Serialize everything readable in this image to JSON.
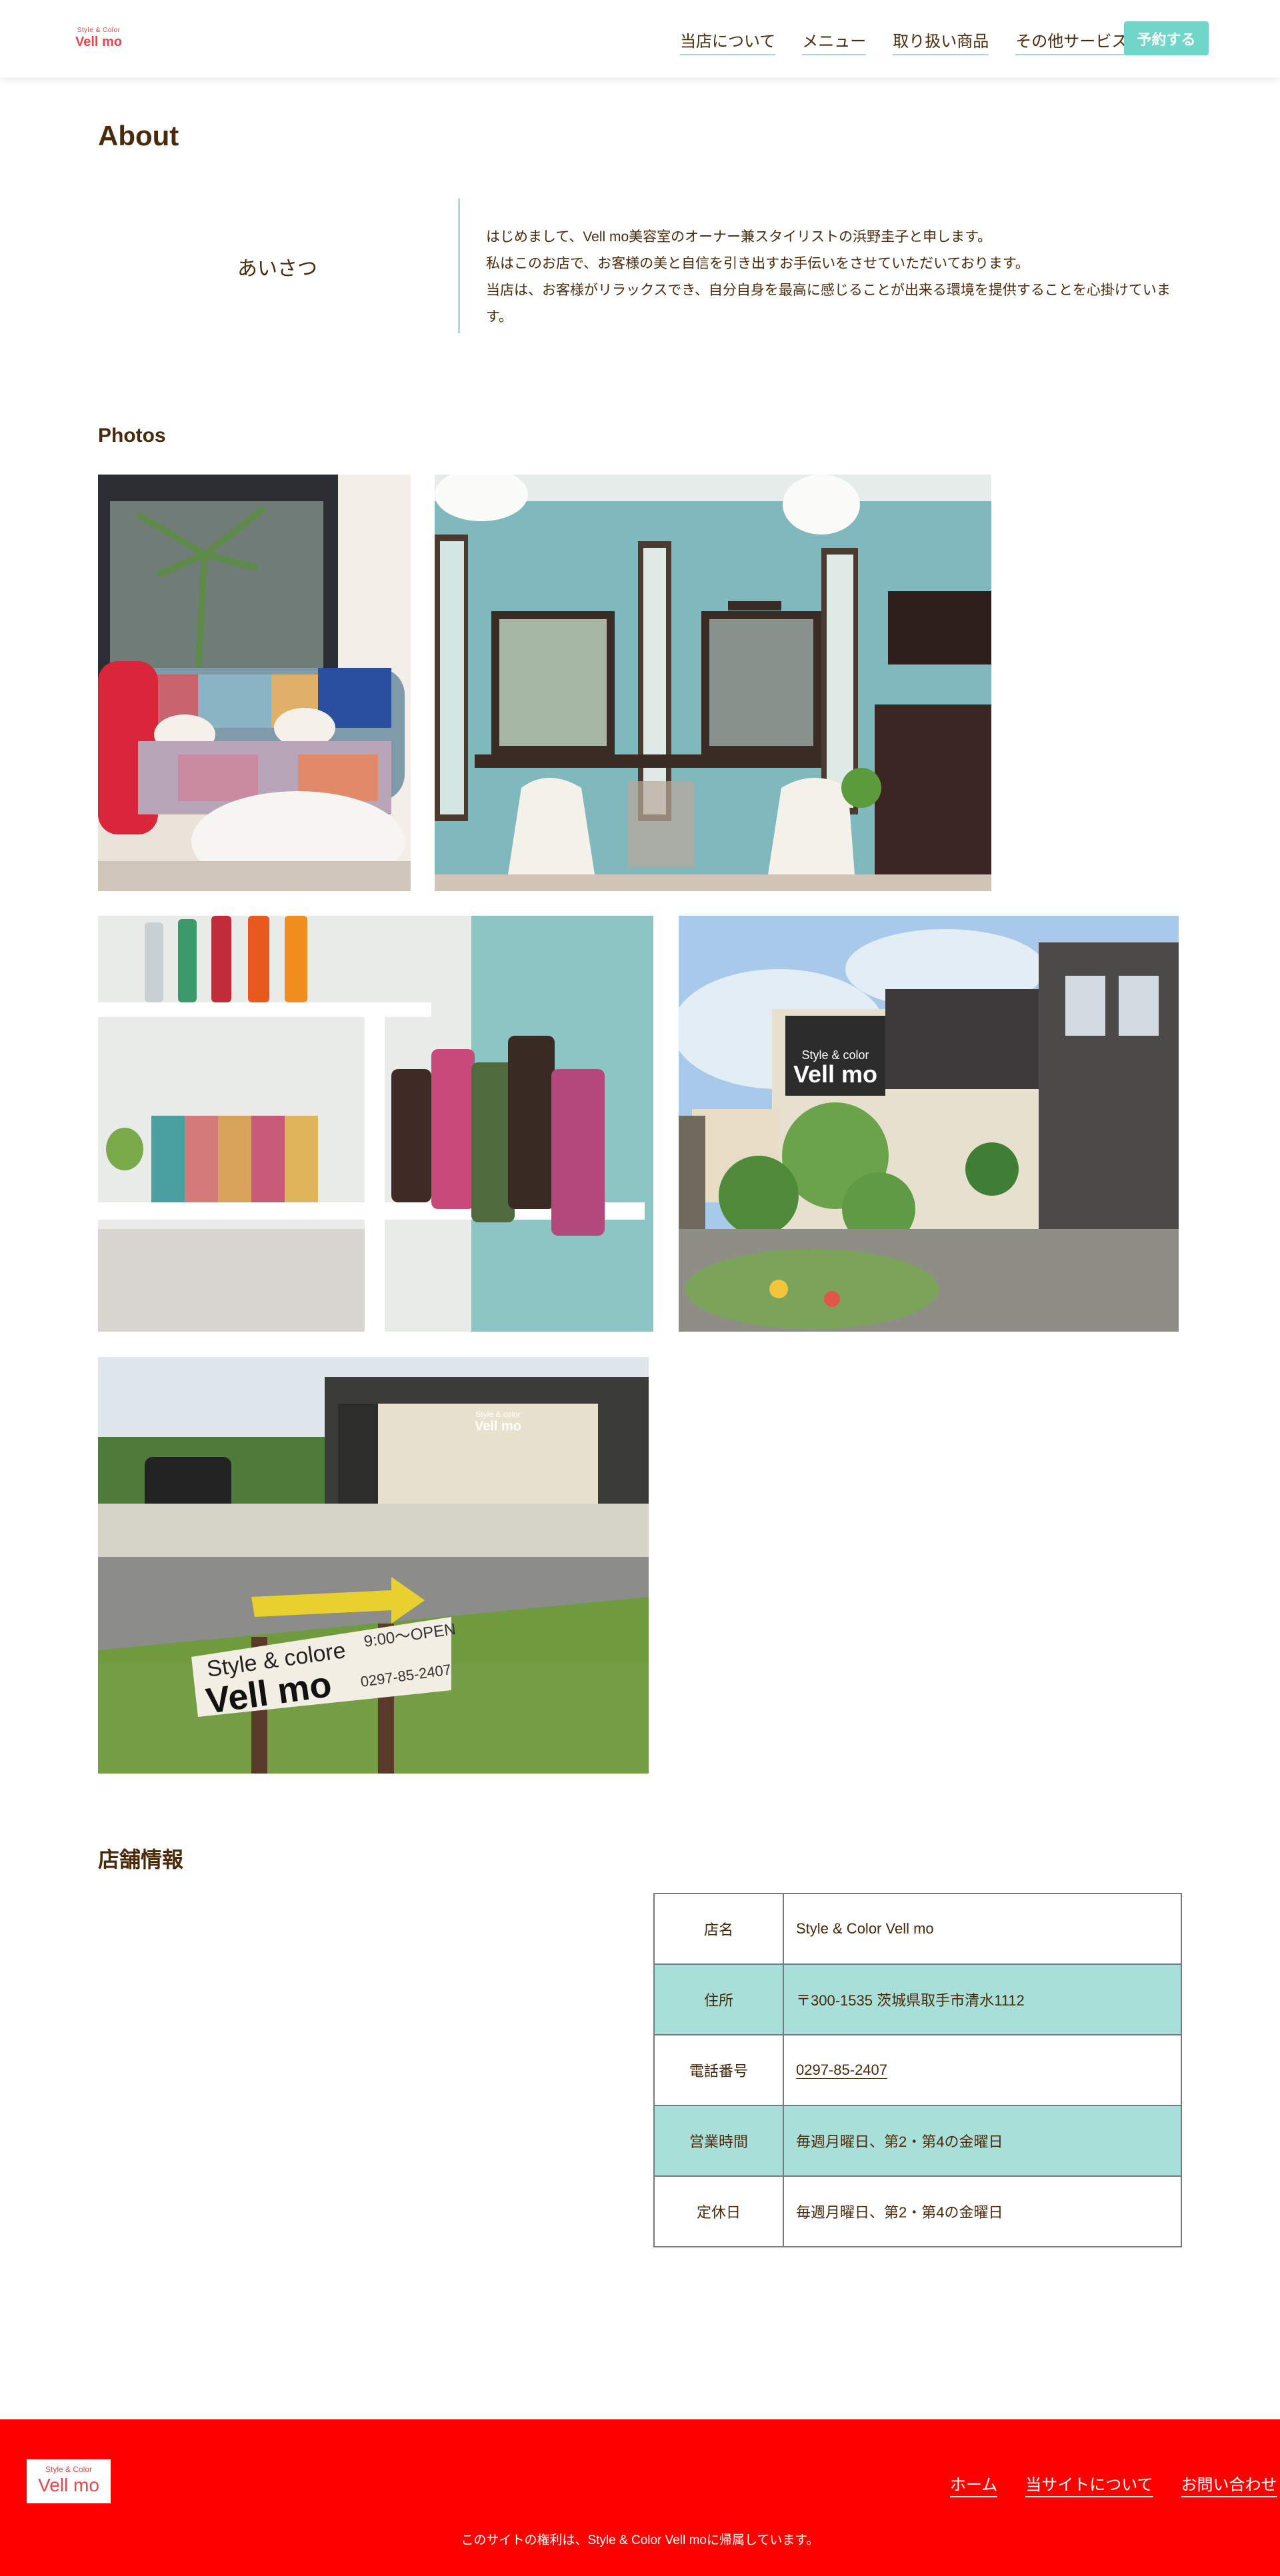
{
  "header": {
    "logo_small": "Style & Color",
    "logo_big": "Vell mo",
    "nav": [
      "当店について",
      "メニュー",
      "取り扱い商品",
      "その他サービス"
    ],
    "reserve_label": "予約する"
  },
  "about": {
    "heading": "About",
    "greeting_label": "あいさつ",
    "greeting_lines": [
      "はじめまして、Vell mo美容室のオーナー兼スタイリストの浜野圭子と申します。",
      "私はこのお店で、お客様の美と自信を引き出すお手伝いをさせていただいております。",
      "当店は、お客様がリラックスでき、自分自身を最高に感じることが出来る環境を提供することを心掛けています。"
    ]
  },
  "photos": {
    "heading": "Photos",
    "sign_line1": "Style & colore",
    "sign_line2": "Vell mo",
    "sign_hours": "9:00〜OPEN",
    "sign_phone": "0297-85-2407",
    "building_sign_small": "Style & color",
    "building_sign_big": "Vell mo",
    "colors": {
      "wall_teal": "#7fb9bd",
      "bottle_pink": "#c94a7a",
      "bottle_green": "#4f6b3e",
      "sky": "#a9c9ea"
    }
  },
  "store": {
    "heading": "店舗情報",
    "rows": [
      {
        "key": "店名",
        "value": "Style & Color Vell mo"
      },
      {
        "key": "住所",
        "value": "〒300-1535 茨城県取手市清水1112"
      },
      {
        "key": "電話番号",
        "value": "0297-85-2407"
      },
      {
        "key": "営業時間",
        "value": "毎週月曜日、第2・第4の金曜日"
      },
      {
        "key": "定休日",
        "value": "毎週月曜日、第2・第4の金曜日"
      }
    ]
  },
  "footer": {
    "logo_small": "Style & Color",
    "logo_big": "Vell mo",
    "nav": [
      "ホーム",
      "当サイトについて",
      "お問い合わせ"
    ],
    "copyright": "このサイトの権利は、Style & Color Vell moに帰属しています。"
  },
  "theme": {
    "accent_teal": "#6fd6c9",
    "row_teal": "#a8e0d9",
    "footer_red": "#ff0000",
    "text_brown": "#4a2a0a"
  }
}
